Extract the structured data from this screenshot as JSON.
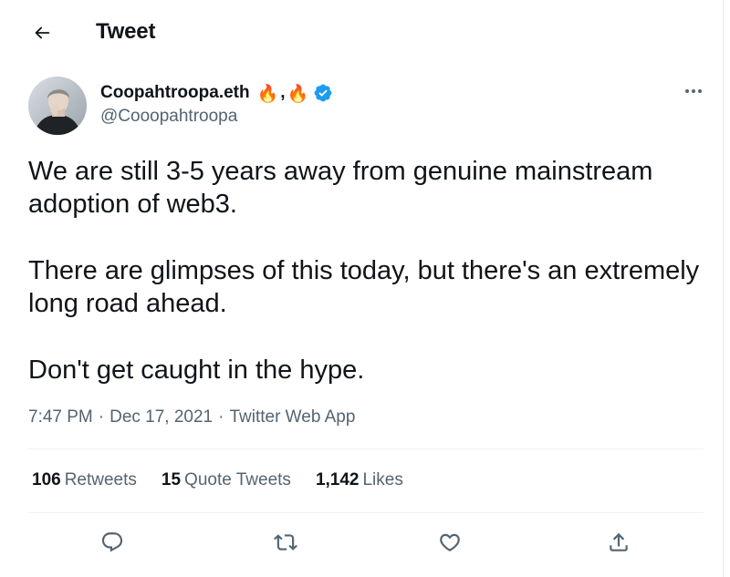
{
  "header": {
    "title": "Tweet"
  },
  "author": {
    "display_name": "Coopahtroopa.eth",
    "name_emojis": [
      "🔥",
      "🔥"
    ],
    "handle": "@Cooopahtroopa",
    "verified": true
  },
  "tweet": {
    "paragraphs": [
      "We are still 3-5 years away from genuine mainstream adoption of web3.",
      "There are glimpses of this today, but there's an extremely long road ahead.",
      "Don't get caught in the hype."
    ],
    "time": "7:47 PM",
    "date": "Dec 17, 2021",
    "source": "Twitter Web App",
    "separator": "·"
  },
  "stats": [
    {
      "value": "106",
      "label": "Retweets"
    },
    {
      "value": "15",
      "label": "Quote Tweets"
    },
    {
      "value": "1,142",
      "label": "Likes"
    }
  ],
  "icons": {
    "back": "arrow-left-icon",
    "verified": "verified-badge-icon",
    "more": "more-horizontal-icon",
    "reply": "reply-icon",
    "retweet": "retweet-icon",
    "like": "heart-icon",
    "share": "share-icon"
  },
  "colors": {
    "text": "#0f1419",
    "secondary": "#536471",
    "verified": "#1d9bf0",
    "divider": "#eff3f4"
  }
}
